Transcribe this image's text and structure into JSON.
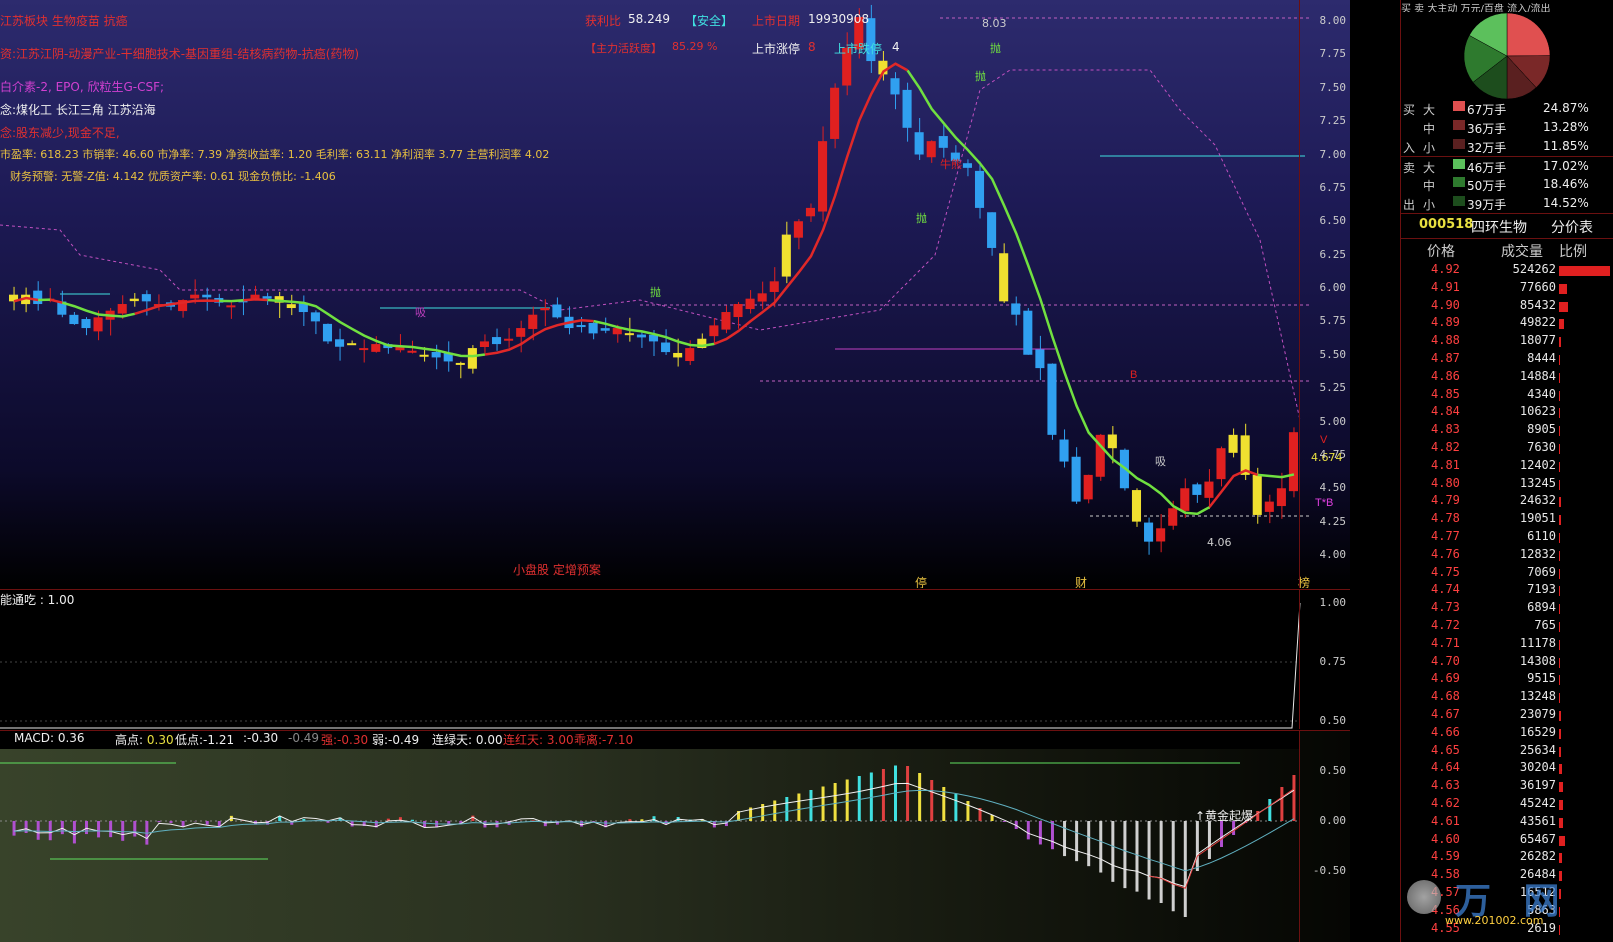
{
  "main": {
    "top_texts": [
      {
        "text": "获利比",
        "x": 0
      },
      {
        "text": "58.249",
        "x": 0
      },
      {
        "text": "【安全】",
        "x": 0
      },
      {
        "text": "上市日期",
        "x": 0
      },
      {
        "text": "19930908",
        "x": 0
      }
    ],
    "profit_label": "获利比",
    "profit_value": "58.249",
    "safety": "【安全】",
    "listing_date_label": "上市日期",
    "listing_date": "19930908",
    "activity_label": "【主力活跃度】",
    "activity_value": "85.29 %",
    "limit_up_label": "上市涨停",
    "limit_up_value": "8",
    "limit_down_label": "上市跌停",
    "limit_down_value": "4",
    "sector_line": "江苏板块 生物疫苗 抗癌",
    "asset_line": "资:江苏江阴-动漫产业-干细胞技术-基因重组-结核病药物-抗癌(药物)",
    "product_line": "白介素-2, EPO, 欣粒生G-CSF;",
    "concept_line": "念:煤化工 长江三角 江苏沿海",
    "shareholder_line": "念:股东减少,现金不足,",
    "finance_line": "市盈率: 618.23 市销率: 46.60 市净率: 7.39 净资收益率: 1.20 毛利率: 63.11 净利润率 3.77 主营利润率 4.02",
    "warning_line": "财务预警: 无警-Z值: 4.142 优质资产率: 0.61 现金负债比: -1.406",
    "bottom_tag": "小盘股 定增预案",
    "markers": [
      "停",
      "财",
      "榜"
    ],
    "high_label": "8.03",
    "low_label": "4.06",
    "price_tag": "4.674",
    "price_axis": [
      "8.00",
      "7.75",
      "7.50",
      "7.25",
      "7.00",
      "6.75",
      "6.50",
      "6.25",
      "6.00",
      "5.75",
      "5.50",
      "5.25",
      "5.00",
      "4.75",
      "4.50",
      "4.25",
      "4.00"
    ],
    "annotations": [
      "抛",
      "抛",
      "抛",
      "抛",
      "吸",
      "吸",
      "牛熊",
      "B",
      "T*B",
      "V"
    ]
  },
  "indicator": {
    "title": "能通吃 : 1.00",
    "axis": [
      "1.00",
      "0.75",
      "0.50"
    ],
    "level": 1.0
  },
  "macd": {
    "labels": [
      {
        "k": "MACD:",
        "v": "0.36"
      },
      {
        "k": "高点:",
        "v": "0.30"
      },
      {
        "k": "低点:",
        "v": "-1.21"
      },
      {
        "k": ":",
        "v": "-0.30"
      },
      {
        "k": "",
        "v": "-0.49"
      },
      {
        "k": "强:",
        "v": "-0.30"
      },
      {
        "k": "弱:",
        "v": "-0.49"
      },
      {
        "k": "连绿天:",
        "v": "0.00"
      },
      {
        "k": "连红天:",
        "v": "3.00"
      },
      {
        "k": "乖离:",
        "v": "-7.10"
      }
    ],
    "axis": [
      "0.50",
      "0.00",
      "-0.50"
    ],
    "gold_label": "↑黄金起爆"
  },
  "right": {
    "header": "买 卖 大主动 万元/百盘 流入/流出",
    "flow": [
      {
        "side": "买",
        "size": "大",
        "amount": "67万手",
        "pct": "24.87%",
        "color": "#e05050"
      },
      {
        "side": "",
        "size": "中",
        "amount": "36万手",
        "pct": "13.28%",
        "color": "#7a2828"
      },
      {
        "side": "入",
        "size": "小",
        "amount": "32万手",
        "pct": "11.85%",
        "color": "#5a2020"
      },
      {
        "side": "卖",
        "size": "大",
        "amount": "46万手",
        "pct": "17.02%",
        "color": "#5cc05c"
      },
      {
        "side": "",
        "size": "中",
        "amount": "50万手",
        "pct": "18.46%",
        "color": "#2e7a2e"
      },
      {
        "side": "出",
        "size": "小",
        "amount": "39万手",
        "pct": "14.52%",
        "color": "#1d4d1d"
      }
    ],
    "stock_code": "000518",
    "stock_name": "四环生物",
    "table_title": "分价表",
    "col_price": "价格",
    "col_volume": "成交量",
    "col_ratio": "比例",
    "rows": [
      {
        "p": "4.92",
        "v": "524262",
        "r": 0.95
      },
      {
        "p": "4.91",
        "v": "77660",
        "r": 0.14
      },
      {
        "p": "4.90",
        "v": "85432",
        "r": 0.16
      },
      {
        "p": "4.89",
        "v": "49822",
        "r": 0.09
      },
      {
        "p": "4.88",
        "v": "18077",
        "r": 0.03
      },
      {
        "p": "4.87",
        "v": "8444",
        "r": 0.015
      },
      {
        "p": "4.86",
        "v": "14884",
        "r": 0.027
      },
      {
        "p": "4.85",
        "v": "4340",
        "r": 0.008
      },
      {
        "p": "4.84",
        "v": "10623",
        "r": 0.02
      },
      {
        "p": "4.83",
        "v": "8905",
        "r": 0.016
      },
      {
        "p": "4.82",
        "v": "7630",
        "r": 0.014
      },
      {
        "p": "4.81",
        "v": "12402",
        "r": 0.022
      },
      {
        "p": "4.80",
        "v": "13245",
        "r": 0.024
      },
      {
        "p": "4.79",
        "v": "24632",
        "r": 0.045
      },
      {
        "p": "4.78",
        "v": "19051",
        "r": 0.035
      },
      {
        "p": "4.77",
        "v": "6110",
        "r": 0.011
      },
      {
        "p": "4.76",
        "v": "12832",
        "r": 0.023
      },
      {
        "p": "4.75",
        "v": "7069",
        "r": 0.013
      },
      {
        "p": "4.74",
        "v": "7193",
        "r": 0.013
      },
      {
        "p": "4.73",
        "v": "6894",
        "r": 0.012
      },
      {
        "p": "4.72",
        "v": "765",
        "r": 0.002
      },
      {
        "p": "4.71",
        "v": "11178",
        "r": 0.02
      },
      {
        "p": "4.70",
        "v": "14308",
        "r": 0.026
      },
      {
        "p": "4.69",
        "v": "9515",
        "r": 0.017
      },
      {
        "p": "4.68",
        "v": "13248",
        "r": 0.024
      },
      {
        "p": "4.67",
        "v": "23079",
        "r": 0.042
      },
      {
        "p": "4.66",
        "v": "16529",
        "r": 0.03
      },
      {
        "p": "4.65",
        "v": "25634",
        "r": 0.046
      },
      {
        "p": "4.64",
        "v": "30204",
        "r": 0.055
      },
      {
        "p": "4.63",
        "v": "36197",
        "r": 0.066
      },
      {
        "p": "4.62",
        "v": "45242",
        "r": 0.082
      },
      {
        "p": "4.61",
        "v": "43561",
        "r": 0.079
      },
      {
        "p": "4.60",
        "v": "65467",
        "r": 0.12
      },
      {
        "p": "4.59",
        "v": "26282",
        "r": 0.048
      },
      {
        "p": "4.58",
        "v": "26484",
        "r": 0.048
      },
      {
        "p": "4.57",
        "v": "16512",
        "r": 0.03
      },
      {
        "p": "4.56",
        "v": "5863",
        "r": 0.011
      },
      {
        "p": "4.55",
        "v": "2619",
        "r": 0.005
      }
    ],
    "watermark": "万 网",
    "watermark_url": "www.201002.com"
  }
}
